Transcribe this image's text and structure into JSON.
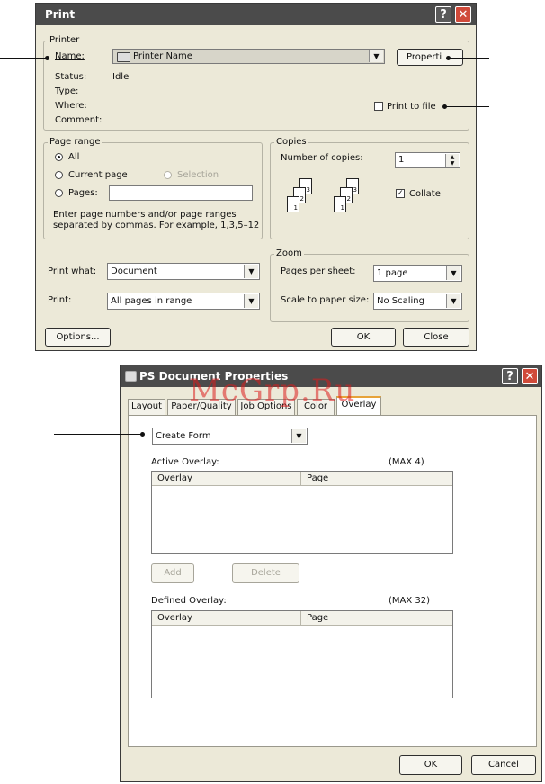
{
  "print_dialog": {
    "title": "Print",
    "help_btn": "?",
    "close_btn": "✕",
    "printer_group": {
      "legend": "Printer",
      "name_label": "Name:",
      "name_value": "Printer Name",
      "properties_button": "Properti",
      "status_label": "Status:",
      "status_value": "Idle",
      "type_label": "Type:",
      "where_label": "Where:",
      "comment_label": "Comment:",
      "print_to_file": "Print to file"
    },
    "page_range": {
      "legend": "Page range",
      "all": "All",
      "current_page": "Current page",
      "selection": "Selection",
      "pages": "Pages:",
      "help_line1": "Enter page numbers and/or page ranges",
      "help_line2": "separated by commas.  For example, 1,3,5–12"
    },
    "copies": {
      "legend": "Copies",
      "number_label": "Number of copies:",
      "number_value": "1",
      "collate": "Collate",
      "stack1": [
        "3",
        "2",
        "1"
      ],
      "stack2": [
        "3",
        "2",
        "1"
      ]
    },
    "print_what_label": "Print what:",
    "print_what_value": "Document",
    "print_label": "Print:",
    "print_value": "All pages in range",
    "zoom": {
      "legend": "Zoom",
      "pages_per_sheet_label": "Pages per sheet:",
      "pages_per_sheet_value": "1 page",
      "scale_label": "Scale to paper size:",
      "scale_value": "No Scaling"
    },
    "options_button": "Options...",
    "ok_button": "OK",
    "close_button": "Close"
  },
  "props_dialog": {
    "title": "PS  Document Properties",
    "help_btn": "?",
    "close_btn": "✕",
    "tabs": [
      "Layout",
      "Paper/Quality",
      "Job Options",
      "Color",
      "Overlay"
    ],
    "form_select_value": "Create Form",
    "active_overlay_label": "Active Overlay:",
    "active_overlay_max": "(MAX 4)",
    "defined_overlay_label": "Defined Overlay:",
    "defined_overlay_max": "(MAX 32)",
    "col_overlay": "Overlay",
    "col_page": "Page",
    "add_button": "Add",
    "delete_button": "Delete",
    "ok_button": "OK",
    "cancel_button": "Cancel"
  },
  "watermark": "McGrp.Ru"
}
